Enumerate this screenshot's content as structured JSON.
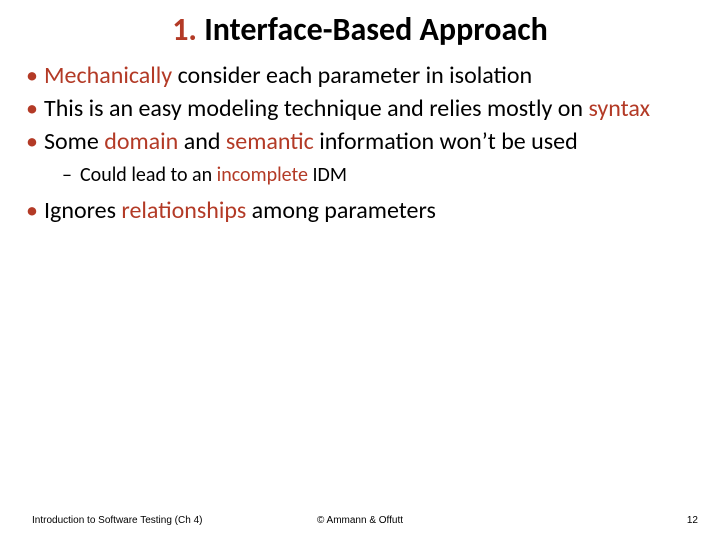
{
  "title": {
    "num": "1.",
    "rest": " Interface-Based Approach"
  },
  "bullets": {
    "b1": {
      "pre": "",
      "hl": "Mechanically",
      "post": " consider each parameter in isolation"
    },
    "b2": {
      "pre": "This is an easy modeling technique and relies mostly on ",
      "hl": "syntax",
      "post": ""
    },
    "b3": {
      "pre": "Some ",
      "hl1": "domain",
      "mid": " and ",
      "hl2": "semantic",
      "post": " information won’t be used"
    },
    "b3s1": {
      "pre": "Could lead to an ",
      "hl": "incomplete",
      "post": " IDM"
    },
    "b4": {
      "pre": "Ignores ",
      "hl": "relationships",
      "post": " among parameters"
    }
  },
  "footer": {
    "left": "Introduction to Software Testing (Ch 4)",
    "center": "© Ammann & Offutt",
    "right": "12"
  }
}
